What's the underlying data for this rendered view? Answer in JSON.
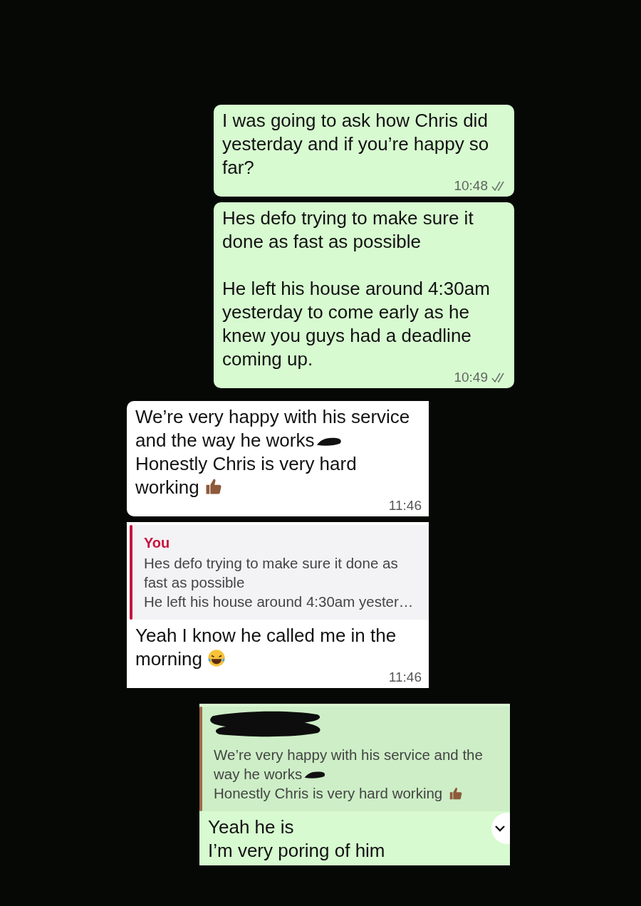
{
  "messages": [
    {
      "kind": "outgoing",
      "paragraphs": [
        {
          "kind": "plain",
          "text": "I was going to ask how Chris did yesterday and if you’re happy so far?"
        }
      ],
      "time": "10:48",
      "read": true
    },
    {
      "kind": "outgoing",
      "paragraphs": [
        {
          "kind": "plain",
          "text": "Hes defo trying to make sure it done as fast as possible"
        },
        {
          "kind": "spaced",
          "text": "He left his house around 4:30am yesterday to come early as he knew you guys had a deadline coming up."
        }
      ],
      "time": "10:49",
      "read": true
    },
    {
      "kind": "incoming",
      "paragraphs": [
        {
          "kind": "redacted_end",
          "text": "We’re very happy with his service and the way he works"
        },
        {
          "kind": "thumbs_up_end",
          "text": "Honestly Chris is very hard working"
        }
      ],
      "time": "11:46"
    },
    {
      "kind": "incoming",
      "quote": {
        "author": "You",
        "color": "#c8143c",
        "lines": [
          {
            "kind": "plain",
            "text": "Hes defo trying to make sure it done as fast as possible"
          },
          {
            "kind": "plain",
            "text": "He left his house around 4:30am yester…"
          }
        ]
      },
      "paragraphs": [
        {
          "kind": "laugh_end",
          "text": "Yeah I know he called me in the morning"
        }
      ],
      "time": "11:46"
    },
    {
      "kind": "outgoing",
      "quote": {
        "color": "#9c6a48",
        "lines": [
          {
            "kind": "redacted_end",
            "text": "We’re very happy with his service and the way he works"
          },
          {
            "kind": "thumbs_up_end",
            "text": "Honestly Chris is very hard working"
          }
        ]
      },
      "paragraphs": [
        {
          "kind": "plain",
          "text": "Yeah he is"
        },
        {
          "kind": "plain",
          "text": "I’m very poring of him"
        }
      ],
      "menu": true
    }
  ]
}
